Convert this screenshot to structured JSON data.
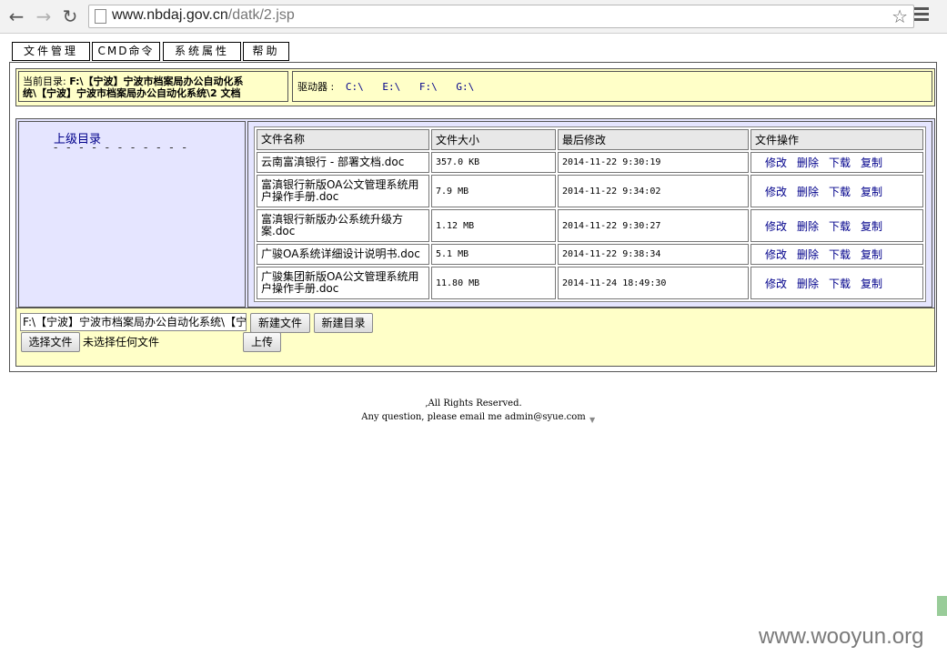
{
  "browser": {
    "url_host": "www.nbdaj.gov.cn",
    "url_path": "/datk/2.jsp",
    "icons": [
      "back-arrow-icon",
      "forward-arrow-icon",
      "reload-icon",
      "page-icon",
      "star-icon",
      "menu-icon"
    ]
  },
  "menu": {
    "file_manage": "文件管理",
    "cmd": "CMD命令",
    "sys_props": "系统属性",
    "help": "帮助"
  },
  "current_dir": {
    "label": "当前目录:",
    "path_line1": "F:\\【宁波】宁波市档案局办公自动化系",
    "path_line2": "统\\【宁波】宁波市档案局办公自动化系统\\2 文档"
  },
  "drives": {
    "label": "驱动器 :",
    "list": [
      "C:\\",
      "E:\\",
      "F:\\",
      "G:\\"
    ]
  },
  "nav": {
    "parent_dir": "上级目录",
    "dashes": "- - - - - - - - - - -"
  },
  "table": {
    "headers": [
      "文件名称",
      "文件大小",
      "最后修改",
      "文件操作"
    ],
    "ops": [
      "修改",
      "删除",
      "下载",
      "复制"
    ],
    "rows": [
      {
        "name1": "云南富滇银行 - 部署文档.doc",
        "name2": "",
        "size": "357.0 KB",
        "modified": "2014-11-22 9:30:19"
      },
      {
        "name1": "富滇银行新版OA公文管理系统用",
        "name2": "户操作手册.doc",
        "size": "7.9 MB",
        "modified": "2014-11-22 9:34:02"
      },
      {
        "name1": "富滇银行新版办公系统升级方",
        "name2": "案.doc",
        "size": "1.12 MB",
        "modified": "2014-11-22 9:30:27"
      },
      {
        "name1": "广骏OA系统详细设计说明书.doc",
        "name2": "",
        "size": "5.1 MB",
        "modified": "2014-11-22 9:38:34"
      },
      {
        "name1": "广骏集团新版OA公文管理系统用",
        "name2": "户操作手册.doc",
        "size": "11.80 MB",
        "modified": "2014-11-24 18:49:30"
      }
    ]
  },
  "actions": {
    "path_value": "F:\\【宁波】宁波市档案局办公自动化系统\\【宁",
    "new_file": "新建文件",
    "new_dir": "新建目录",
    "choose_file": "选择文件",
    "no_file": "未选择任何文件",
    "upload": "上传"
  },
  "footer": {
    "line1": ",All Rights Reserved.",
    "line2": "Any question, please email me admin@syue.com"
  },
  "watermark": "www.wooyun.org"
}
